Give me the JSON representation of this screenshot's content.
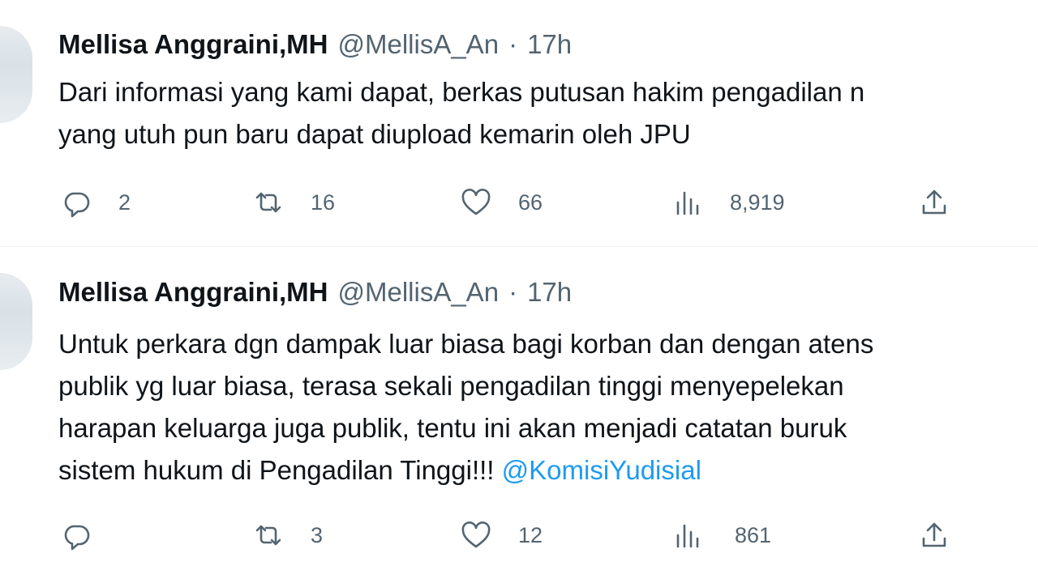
{
  "tweets": [
    {
      "name": "Mellisa Anggraini,MH",
      "handle": "@MellisA_An",
      "separator": "·",
      "time": "17h",
      "lines": [
        "Dari informasi yang kami dapat, berkas putusan hakim pengadilan n",
        "yang utuh pun baru dapat diupload kemarin oleh JPU"
      ],
      "replies": "2",
      "retweets": "16",
      "likes": "66",
      "views": "8,919"
    },
    {
      "name": "Mellisa Anggraini,MH",
      "handle": "@MellisA_An",
      "separator": "·",
      "time": "17h",
      "lines": [
        "Untuk perkara dgn dampak luar biasa bagi korban dan dengan atens",
        "publik yg luar biasa, terasa sekali pengadilan tinggi menyepelekan",
        "harapan keluarga juga publik, tentu ini akan menjadi catatan buruk",
        "sistem hukum di Pengadilan Tinggi!!! "
      ],
      "mention": "@KomisiYudisial",
      "replies": "",
      "retweets": "3",
      "likes": "12",
      "views": "861"
    }
  ],
  "icons": {
    "reply": "reply-icon",
    "retweet": "retweet-icon",
    "like": "heart-icon",
    "views": "views-icon",
    "share": "share-icon"
  },
  "colors": {
    "text": "#0f1419",
    "secondary": "#536471",
    "link": "#1d9bf0",
    "divider": "#eff3f4"
  }
}
